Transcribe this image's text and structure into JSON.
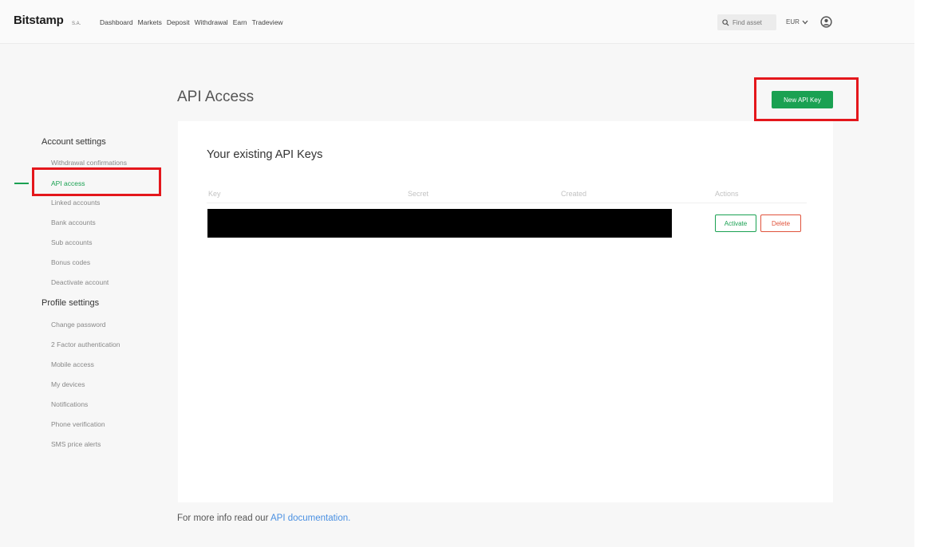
{
  "brand": {
    "name": "Bitstamp",
    "suffix": "S.A."
  },
  "nav": [
    "Dashboard",
    "Markets",
    "Deposit",
    "Withdrawal",
    "Earn",
    "Tradeview"
  ],
  "search": {
    "placeholder": "Find asset"
  },
  "currency": "EUR",
  "page": {
    "title": "API Access",
    "new_key_label": "New API Key"
  },
  "sidebar": {
    "account_heading": "Account settings",
    "account_items": [
      "Withdrawal confirmations",
      "API access",
      "Linked accounts",
      "Bank accounts",
      "Sub accounts",
      "Bonus codes",
      "Deactivate account"
    ],
    "profile_heading": "Profile settings",
    "profile_items": [
      "Change password",
      "2 Factor authentication",
      "Mobile access",
      "My devices",
      "Notifications",
      "Phone verification",
      "SMS price alerts"
    ]
  },
  "keys": {
    "title": "Your existing API Keys",
    "columns": [
      "Key",
      "Secret",
      "Created",
      "Actions"
    ],
    "activate_label": "Activate",
    "delete_label": "Delete"
  },
  "footer": {
    "text": "For more info read our ",
    "link": "API documentation."
  },
  "colors": {
    "accent": "#1aa152",
    "danger": "#e0533c",
    "highlight": "#e4171c",
    "link": "#4a90e2"
  }
}
